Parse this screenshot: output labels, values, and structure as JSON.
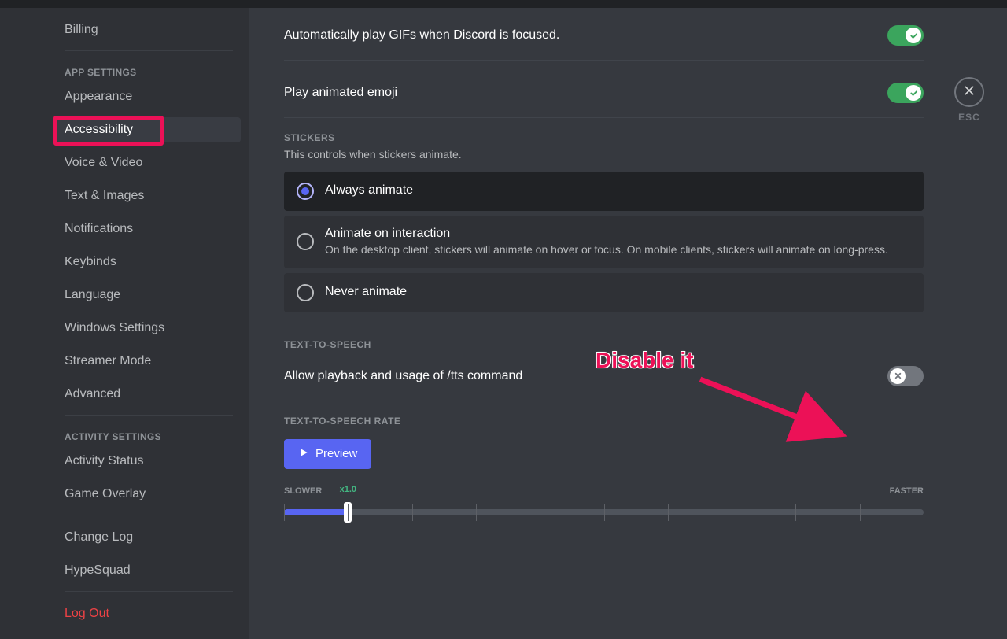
{
  "sidebar": {
    "headers": {
      "app": "APP SETTINGS",
      "activity": "ACTIVITY SETTINGS"
    },
    "billing": "Billing",
    "appearance": "Appearance",
    "accessibility": "Accessibility",
    "voice_video": "Voice & Video",
    "text_images": "Text & Images",
    "notifications": "Notifications",
    "keybinds": "Keybinds",
    "language": "Language",
    "windows_settings": "Windows Settings",
    "streamer_mode": "Streamer Mode",
    "advanced": "Advanced",
    "activity_status": "Activity Status",
    "game_overlay": "Game Overlay",
    "change_log": "Change Log",
    "hypesquad": "HypeSquad",
    "log_out": "Log Out"
  },
  "settings": {
    "auto_gif": "Automatically play GIFs when Discord is focused.",
    "animated_emoji": "Play animated emoji",
    "stickers_title": "STICKERS",
    "stickers_desc": "This controls when stickers animate.",
    "radio": {
      "always": "Always animate",
      "interaction_title": "Animate on interaction",
      "interaction_desc": "On the desktop client, stickers will animate on hover or focus. On mobile clients, stickers will animate on long-press.",
      "never": "Never animate"
    },
    "tts_title": "TEXT-TO-SPEECH",
    "tts_allow": "Allow playback and usage of /tts command",
    "tts_rate_title": "TEXT-TO-SPEECH RATE",
    "preview": "Preview",
    "slower": "SLOWER",
    "faster": "FASTER",
    "rate_current": "x1.0",
    "rate_percent": 10
  },
  "esc": {
    "label": "ESC"
  },
  "annotation": {
    "text": "Disable it"
  }
}
